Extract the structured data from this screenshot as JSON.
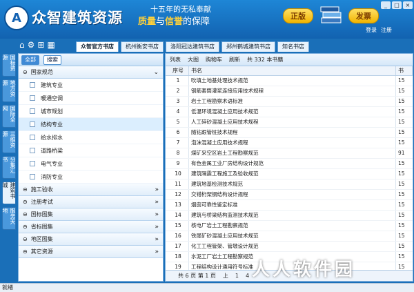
{
  "header": {
    "brand": "众智建筑资源",
    "slogan_top": "十五年的无私奉献",
    "slogan_a": "质量",
    "slogan_mid": "与",
    "slogan_b": "信誉",
    "slogan_end": "的保障",
    "zhengban": "正版",
    "fabiao": "发票",
    "login": "登录",
    "register": "注册"
  },
  "store_tabs": [
    "众智官方书店",
    "杭州衡安书店",
    "洛阳冠达建筑书店",
    "郑州鹤城建筑书店",
    "知名书店"
  ],
  "vtabs": [
    "国标资源",
    "地方资源",
    "国际全网",
    "三维资源",
    "分集汇书",
    "建筑书城",
    "服务天地"
  ],
  "left": {
    "all": "全部",
    "search": "搜索",
    "groups": [
      {
        "label": "国家规范",
        "open": true,
        "items": [
          "建筑专业",
          "暖通空调",
          "城市规划",
          "结构专业",
          "给水排水",
          "道路桥梁",
          "电气专业",
          "消防专业"
        ]
      },
      {
        "label": "施工验收"
      },
      {
        "label": "注册考试"
      },
      {
        "label": "国标图集"
      },
      {
        "label": "省标图集"
      },
      {
        "label": "地区图集"
      },
      {
        "label": "其它资源"
      }
    ]
  },
  "right": {
    "list": "列表",
    "big": "大图",
    "cart": "购物车",
    "refresh": "刷新",
    "count": "共 332 本书籍",
    "col_no": "序号",
    "col_name": "书名",
    "col_x": "书",
    "rows": [
      [
        "1",
        "吹填土地基处理技术规范",
        "15"
      ],
      [
        "2",
        "钢筋套筒灌浆连接应用技术规程",
        "15"
      ],
      [
        "3",
        "岩土工程勘察术语标准",
        "15"
      ],
      [
        "4",
        "低温环境混凝土应用技术规范",
        "15"
      ],
      [
        "5",
        "人工碎砂混凝土应用技术规程",
        "15"
      ],
      [
        "6",
        "随钻跟管桩技术规程",
        "15"
      ],
      [
        "7",
        "泡沫混凝土应用技术规程",
        "15"
      ],
      [
        "8",
        "煤矿采空区岩土工程勘察规范",
        "91"
      ],
      [
        "9",
        "有色金属工业厂房结构设计规范",
        "15"
      ],
      [
        "10",
        "建筑隔震工程施工及验收规范",
        "15"
      ],
      [
        "11",
        "建筑地基检测技术规范",
        "15"
      ],
      [
        "12",
        "交错桁架钢结构设计规程",
        "15"
      ],
      [
        "13",
        "烟囱可靠性鉴定标准",
        "15"
      ],
      [
        "14",
        "建筑与桥梁结构监测技术规范",
        "15"
      ],
      [
        "15",
        "核电厂岩土工程勘察规范",
        "15"
      ],
      [
        "16",
        "铁尾矿砂混凝土应用技术规范",
        "15"
      ],
      [
        "17",
        "化工工程管架、管墩设计规范",
        "15"
      ],
      [
        "18",
        "水泥工厂岩土工程勘察规范",
        "15"
      ],
      [
        "19",
        "工程结构设计通用符号标准",
        "15"
      ]
    ],
    "pager": [
      "共 6 页 第 1 页",
      "上",
      "1",
      "4"
    ]
  },
  "status": "就绪",
  "watermark": "人人软件园"
}
